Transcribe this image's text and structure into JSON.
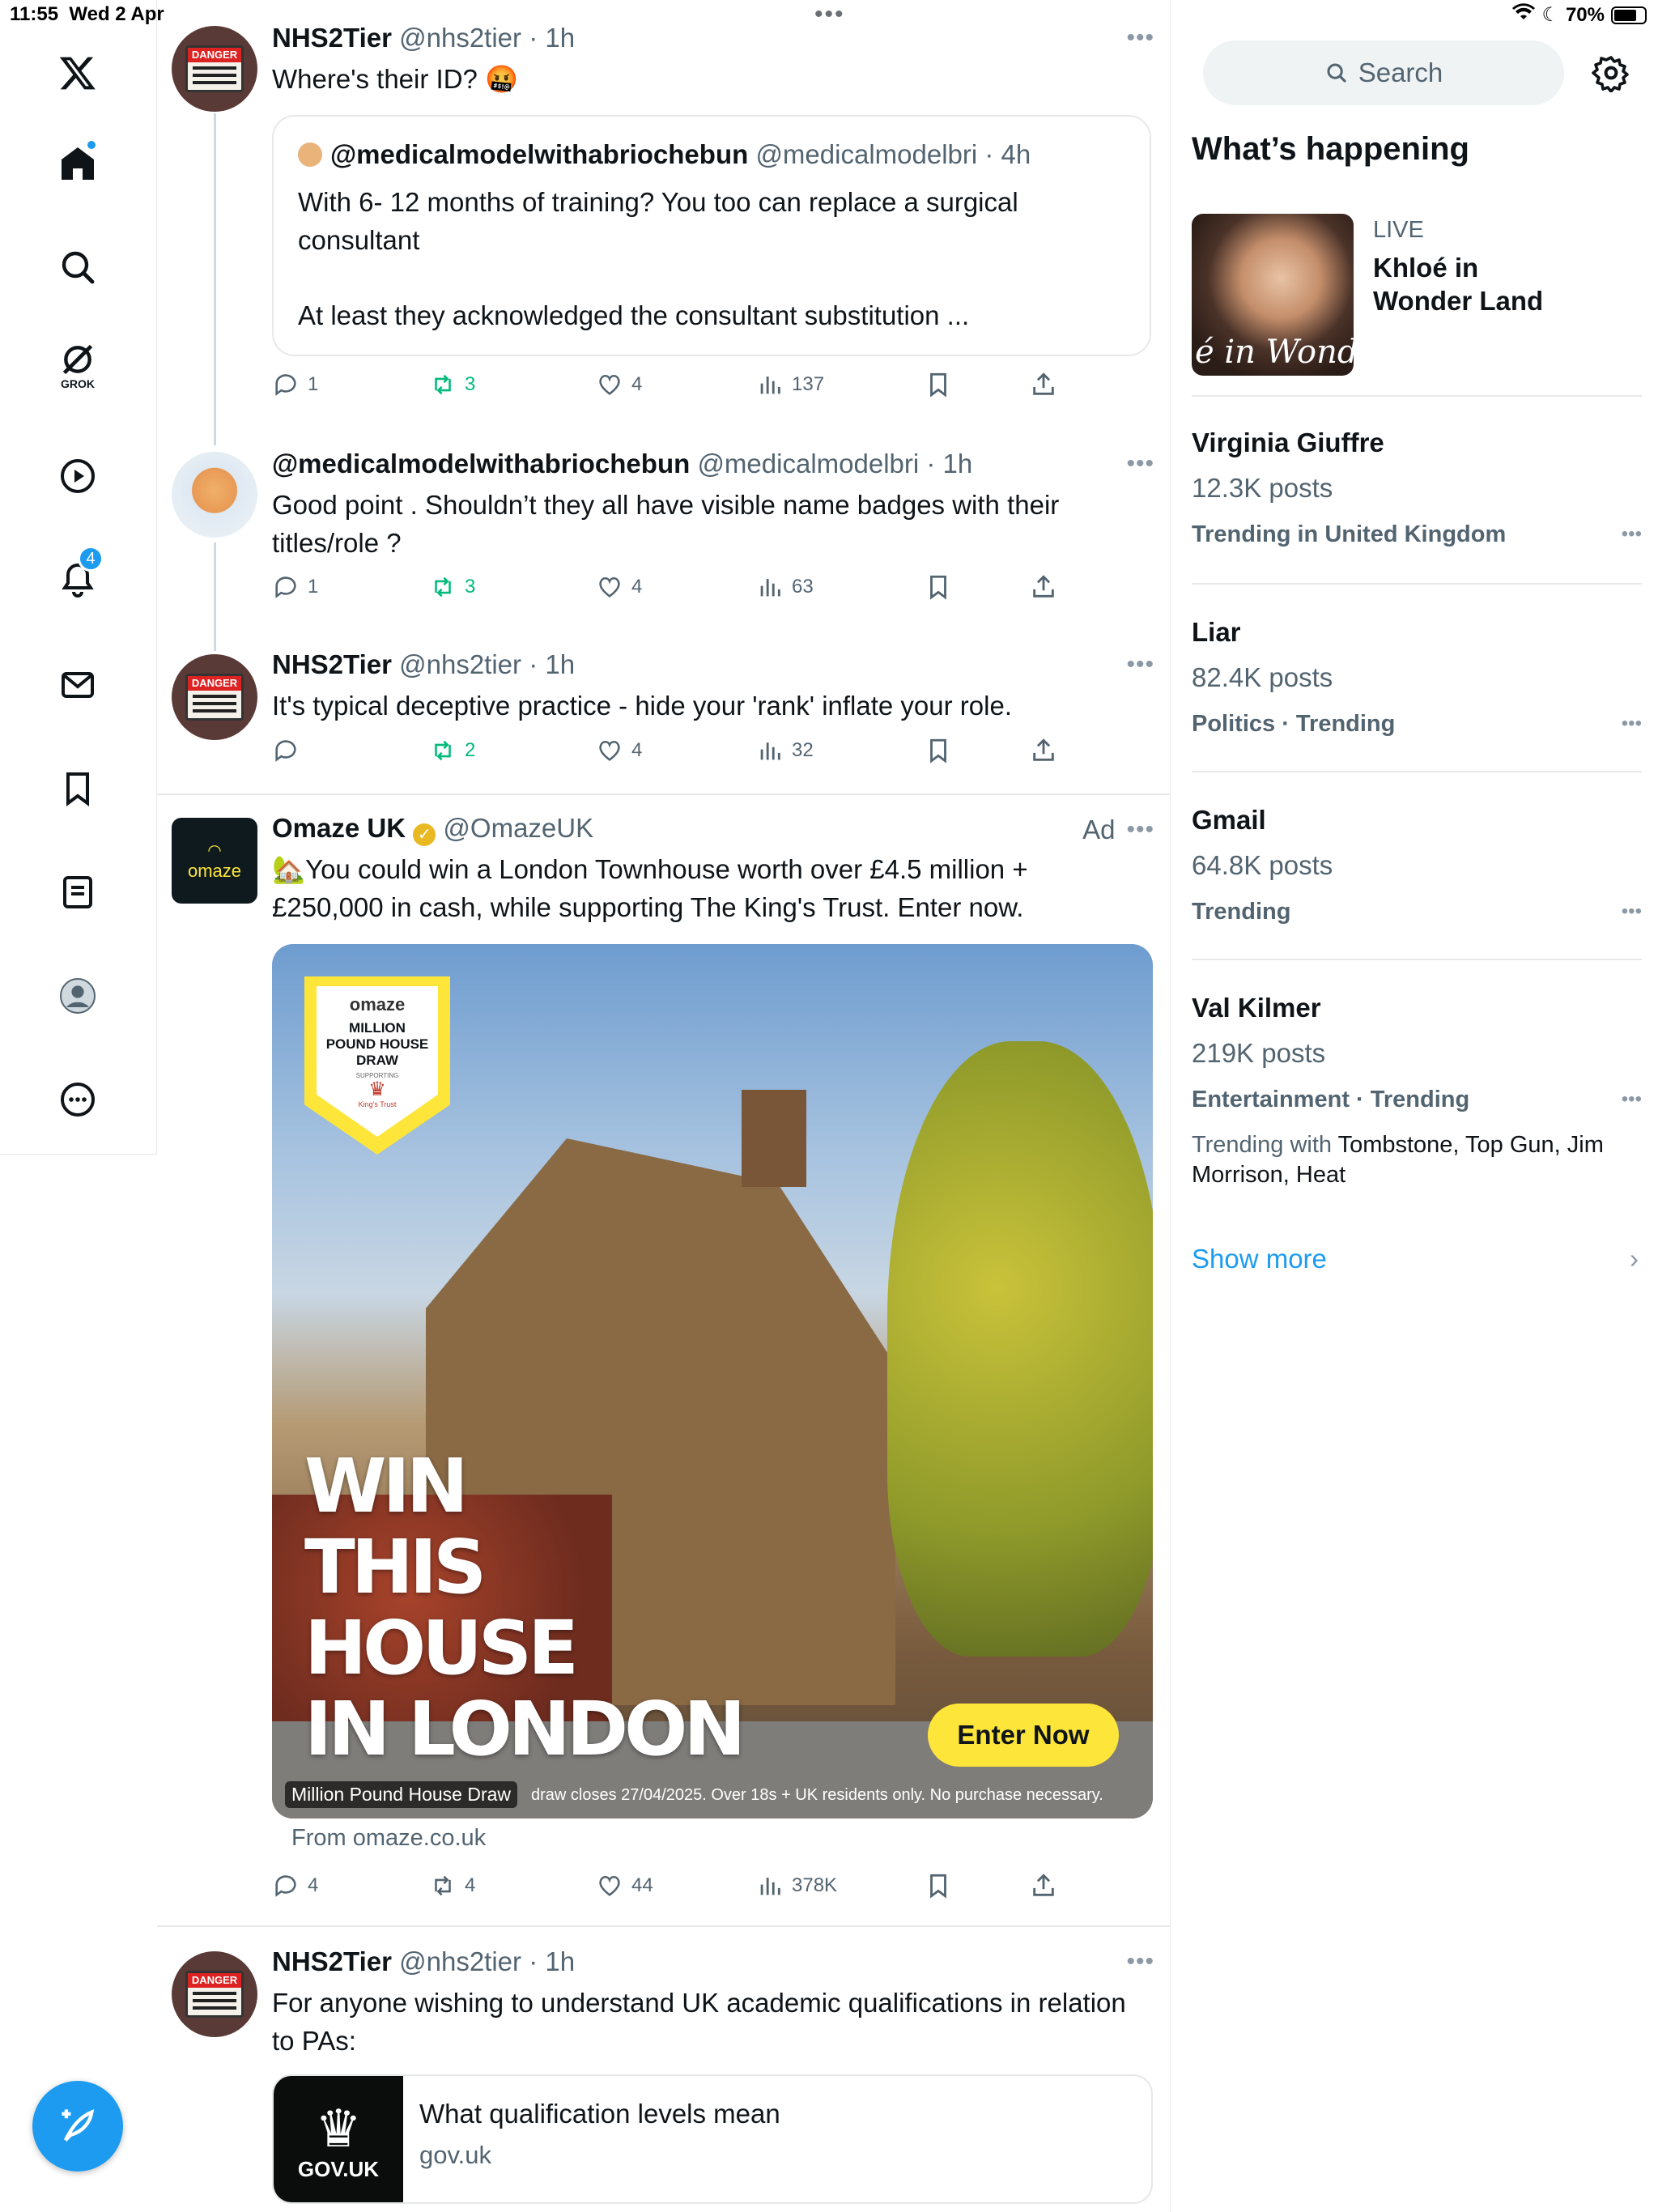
{
  "status_bar": {
    "time": "11:55",
    "date": "Wed 2 Apr",
    "battery": "70%"
  },
  "nav": {
    "items": [
      "home",
      "explore",
      "grok",
      "video",
      "notifications",
      "messages",
      "bookmarks",
      "lists",
      "profile",
      "more"
    ],
    "grok_label": "GROK",
    "notifications_count": "4"
  },
  "tweets": [
    {
      "name": "NHS2Tier",
      "handle": "@nhs2tier · 1h",
      "text": "Where's their ID? 🤬",
      "avatar_text": "DANGER",
      "quote": {
        "name": "@medicalmodelwithabriochebun",
        "handle": "@medicalmodelbri · 4h",
        "text1": "With 6- 12 months of training? You too can replace a surgical consultant",
        "text2": "At least they acknowledged the consultant substitution ..."
      },
      "replies": "1",
      "retweets": "3",
      "likes": "4",
      "views": "137"
    },
    {
      "name": "@medicalmodelwithabriochebun",
      "handle": "@medicalmodelbri · 1h",
      "text": "Good point . Shouldn’t they all have visible name badges with their titles/role ?",
      "replies": "1",
      "retweets": "3",
      "likes": "4",
      "views": "63"
    },
    {
      "name": "NHS2Tier",
      "handle": "@nhs2tier · 1h",
      "text": "It's typical deceptive practice - hide your 'rank' inflate your role.",
      "avatar_text": "DANGER",
      "replies": "",
      "retweets": "2",
      "likes": "4",
      "views": "32"
    },
    {
      "name": "Omaze UK",
      "handle": "@OmazeUK",
      "ad_label": "Ad",
      "avatar_text": "omaze",
      "text": "🏡You could win a London Townhouse worth over £4.5 million + £250,000 in cash, while supporting The King's Trust. Enter now.",
      "image": {
        "headline": [
          "WIN",
          "THIS",
          "HOUSE",
          "IN LONDON"
        ],
        "cta": "Enter Now",
        "badge_brand": "omaze",
        "badge_title": "MILLION POUND HOUSE DRAW",
        "badge_supporting": "SUPPORTING",
        "badge_trust": "King's Trust",
        "caption": "Million Pound House Draw",
        "fineprint": "draw closes 27/04/2025. Over 18s + UK residents only. No purchase necessary."
      },
      "source": "From omaze.co.uk",
      "replies": "4",
      "retweets": "4",
      "likes": "44",
      "views": "378K"
    },
    {
      "name": "NHS2Tier",
      "handle": "@nhs2tier · 1h",
      "text": "For anyone wishing to understand UK academic qualifications in relation to PAs:",
      "avatar_text": "DANGER",
      "card": {
        "logo": "GOV.UK",
        "title": "What qualification levels mean",
        "domain": "gov.uk"
      }
    }
  ],
  "sidebar": {
    "search_placeholder": "Search",
    "heading": "What’s happening",
    "live": {
      "label": "LIVE",
      "title": "Khloé in Wonder Land",
      "thumb_text": "é in Wonder l"
    },
    "trends": [
      {
        "title": "Virginia Giuffre",
        "posts": "12.3K posts",
        "meta": "Trending in United Kingdom"
      },
      {
        "title": "Liar",
        "posts": "82.4K posts",
        "meta": "Politics · Trending"
      },
      {
        "title": "Gmail",
        "posts": "64.8K posts",
        "meta": "Trending"
      },
      {
        "title": "Val Kilmer",
        "posts": "219K posts",
        "meta": "Entertainment · Trending",
        "with_label": "Trending with",
        "with": "Tombstone, Top Gun, Jim Morrison, Heat"
      }
    ],
    "show_more": "Show more"
  },
  "colors": {
    "accent": "#1d9bf0",
    "retweet_green": "#00ba7c",
    "omaze_yellow": "#fde53a",
    "text_secondary": "#536471"
  }
}
